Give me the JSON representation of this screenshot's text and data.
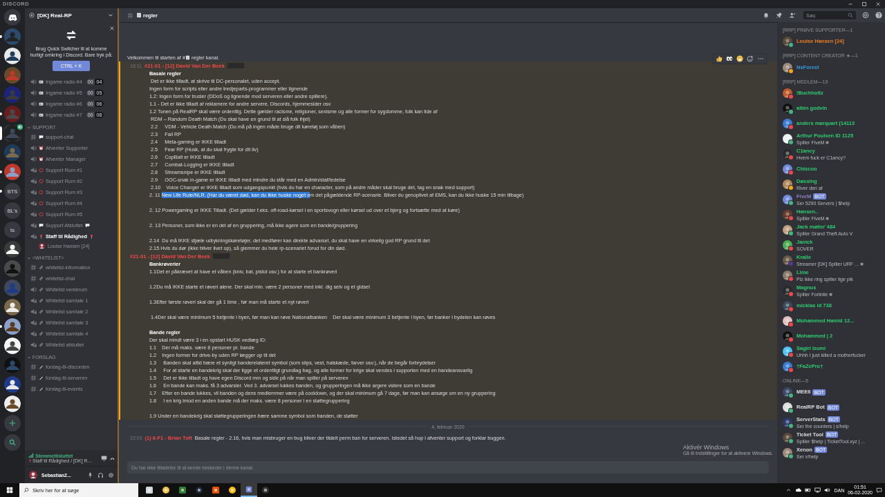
{
  "titlebar": {
    "app": "DISCORD"
  },
  "servers": [
    {
      "kind": "home",
      "selected": false,
      "unread": false
    },
    {
      "kind": "picture",
      "selected": false,
      "unread": true
    },
    {
      "kind": "picture",
      "selected": false,
      "unread": false
    },
    {
      "kind": "picture",
      "selected": false,
      "unread": false
    },
    {
      "kind": "picture",
      "selected": false,
      "unread": false
    },
    {
      "kind": "picture",
      "selected": false,
      "unread": true
    },
    {
      "kind": "picture",
      "selected": true,
      "unread": false,
      "voice": true
    },
    {
      "kind": "picture",
      "selected": false,
      "unread": false
    },
    {
      "kind": "picture",
      "selected": false,
      "unread": true
    },
    {
      "kind": "text",
      "label": "BTS",
      "selected": false,
      "unread": true
    },
    {
      "kind": "text",
      "label": "BL's",
      "selected": false,
      "unread": false
    },
    {
      "kind": "text",
      "label": "ts",
      "selected": false,
      "unread": false
    },
    {
      "kind": "picture",
      "selected": false,
      "unread": false
    },
    {
      "kind": "picture",
      "selected": false,
      "unread": false
    },
    {
      "kind": "picture",
      "selected": false,
      "unread": false
    },
    {
      "kind": "picture",
      "selected": false,
      "unread": false
    },
    {
      "kind": "picture",
      "selected": false,
      "unread": true
    },
    {
      "kind": "picture",
      "selected": false,
      "unread": false
    },
    {
      "kind": "picture",
      "selected": false,
      "unread": false
    },
    {
      "kind": "picture",
      "selected": false,
      "unread": false
    },
    {
      "kind": "picture",
      "selected": false,
      "unread": false
    },
    {
      "kind": "add",
      "selected": false,
      "unread": false
    },
    {
      "kind": "explore",
      "selected": false,
      "unread": false
    }
  ],
  "guild": {
    "name": "[DK] Real-RP"
  },
  "quick_switcher": {
    "text": "Brug Quick Switcher til at komme hurtigt omkring i Discord. Bare tryk på:",
    "shortcut": "CTRL + K"
  },
  "channel_groups": [
    {
      "channels": [
        {
          "icons": [
            {
              "kind": "speaker"
            },
            {
              "kind": "radio"
            }
          ],
          "name": "Ingame radio #4",
          "counts": [
            "00",
            "04"
          ]
        },
        {
          "icons": [
            {
              "kind": "speaker"
            },
            {
              "kind": "radio"
            }
          ],
          "name": "Ingame radio #5",
          "counts": [
            "00",
            "05"
          ]
        },
        {
          "icons": [
            {
              "kind": "speaker"
            },
            {
              "kind": "radio"
            }
          ],
          "name": "Ingame radio #6",
          "counts": [
            "00",
            "06"
          ]
        },
        {
          "icons": [
            {
              "kind": "speaker"
            },
            {
              "kind": "radio"
            }
          ],
          "name": "Ingame radio #7",
          "counts": [
            "00",
            "08"
          ]
        }
      ]
    },
    {
      "name": "SUPPORT",
      "expanded": true,
      "channels": [
        {
          "icons": [
            {
              "kind": "hash"
            },
            {
              "kind": "speech"
            }
          ],
          "name": "support-chat"
        },
        {
          "icons": [
            {
              "kind": "speaker"
            },
            {
              "kind": "clock"
            }
          ],
          "name": "Afventer Supporter"
        },
        {
          "icons": [
            {
              "kind": "speaker"
            },
            {
              "kind": "clock"
            }
          ],
          "name": "Afventer Manager"
        },
        {
          "icons": [
            {
              "kind": "locked"
            },
            {
              "kind": "ring"
            }
          ],
          "name": "Support Rum #1"
        },
        {
          "icons": [
            {
              "kind": "locked"
            },
            {
              "kind": "ring"
            }
          ],
          "name": "Support Rum #2"
        },
        {
          "icons": [
            {
              "kind": "locked"
            },
            {
              "kind": "ring"
            }
          ],
          "name": "Support Rum #3"
        },
        {
          "icons": [
            {
              "kind": "locked"
            },
            {
              "kind": "ring"
            }
          ],
          "name": "Support Rum #4"
        },
        {
          "icons": [
            {
              "kind": "locked"
            },
            {
              "kind": "ring"
            }
          ],
          "name": "Support Rum #5"
        },
        {
          "icons": [
            {
              "kind": "locked"
            },
            {
              "kind": "speech"
            }
          ],
          "icons_after": [
            {
              "kind": "speech"
            }
          ],
          "name": "Support Afsluttet"
        },
        {
          "icons": [
            {
              "kind": "locked"
            },
            {
              "kind": "pin"
            }
          ],
          "icons_after": [
            {
              "kind": "pin"
            }
          ],
          "name": "Staff til Rådighed",
          "connected": true,
          "members": [
            {
              "name": "Louise Hansen [24]"
            }
          ]
        }
      ]
    },
    {
      "name": "=WHITELIST=",
      "expanded": true,
      "channels": [
        {
          "icons": [
            {
              "kind": "hash"
            },
            {
              "kind": "link"
            }
          ],
          "name": "whitelist-information"
        },
        {
          "icons": [
            {
              "kind": "hash"
            },
            {
              "kind": "link"
            }
          ],
          "name": "whitelist-chat"
        },
        {
          "icons": [
            {
              "kind": "speaker"
            },
            {
              "kind": "link"
            }
          ],
          "name": "Whitelist venterum"
        },
        {
          "icons": [
            {
              "kind": "locked"
            },
            {
              "kind": "link"
            }
          ],
          "name": "Whitelist samtale 1"
        },
        {
          "icons": [
            {
              "kind": "locked"
            },
            {
              "kind": "link"
            }
          ],
          "name": "Whitelist samtale 2"
        },
        {
          "icons": [
            {
              "kind": "locked"
            },
            {
              "kind": "link"
            }
          ],
          "name": "Whitelist samtale 3"
        },
        {
          "icons": [
            {
              "kind": "locked"
            },
            {
              "kind": "link"
            }
          ],
          "name": "Whitelist samtale 4"
        },
        {
          "icons": [
            {
              "kind": "locked"
            },
            {
              "kind": "link"
            }
          ],
          "name": "Whitelist afsluttet"
        }
      ]
    },
    {
      "name": "FORSLAG",
      "expanded": true,
      "channels": [
        {
          "icons": [
            {
              "kind": "hash"
            },
            {
              "kind": "pencil"
            }
          ],
          "name": "forslag-til-discorden"
        },
        {
          "icons": [
            {
              "kind": "hash"
            },
            {
              "kind": "pencil"
            }
          ],
          "name": "forslag-til-serveren"
        },
        {
          "icons": [
            {
              "kind": "hash"
            },
            {
              "kind": "pencil"
            }
          ],
          "name": "forslag-til-events"
        }
      ]
    }
  ],
  "voice_panel": {
    "status": "Stemmetilsluttet",
    "location": "Staff til Rådighed / [DK] R..."
  },
  "user_panel": {
    "name": "Sebastian2..."
  },
  "channel": {
    "name": "regler"
  },
  "search": {
    "placeholder": "Søg"
  },
  "welcome": {
    "before": "Velkommen til starten af #",
    "after": "regler kanal."
  },
  "messages": [
    {
      "kind": "group",
      "time": "16:11",
      "author": "#21-01 - [12] David Van Der Beek",
      "color": "#f04747",
      "mentioned": true,
      "hovered": true,
      "lines": [
        {
          "kind": "heading",
          "text": "Basale regler"
        },
        {
          "kind": "text",
          "text": " Det er ikke tilladt, at skrive til DC-personalet, uden accept."
        },
        {
          "kind": "text",
          "text": "Ingen form for scripts eller andre tredjeparts-programmer eller lignende"
        },
        {
          "kind": "text",
          "text": "1.2: Ingen form for trusler (DDoS og lignende mod serveren eller andre spillere)."
        },
        {
          "kind": "text",
          "text": "1.1 - Det er ikke tilladt af reklamere for andre servere, Discords, hjemmesider osv"
        },
        {
          "kind": "text",
          "text": "1.2 Tonen på RealRP skal være ordentlig. Dette gælder racisme, religioner, sexisme og alle former for sygdomme, folk kan lide af"
        },
        {
          "kind": "text",
          "text": " RDM – Random Death Match (Du skal have en grund til at slå folk ihjel)"
        },
        {
          "kind": "text",
          "text": " 2.2     VDM - Vehicle Death Match (Du må på ingen måde bruge dit køretøj som våben)"
        },
        {
          "kind": "text",
          "text": " 2.3     Fail RP"
        },
        {
          "kind": "text",
          "text": " 2.4     Meta-gaming er IKKE tilladt"
        },
        {
          "kind": "text",
          "text": " 2.5     Fear RP (Husk, at du skal frygte for dit liv)"
        },
        {
          "kind": "text",
          "text": " 2.6     CopBait er IKKE tilladt"
        },
        {
          "kind": "text",
          "text": " 2.7     Combat-Logging er IKKE tilladt"
        },
        {
          "kind": "text",
          "text": " 2.8     Streamsnipe er IKKE tilladt"
        },
        {
          "kind": "text",
          "text": " 2.9     OOC-snak in-game er IKKE tilladt med mindre du står med en Admin/staf/ledelse"
        },
        {
          "kind": "text",
          "text": " 2.10    Voice Changer er IKKE tilladt som udgangspunkt (hvis du har en character, som på andre måder skal bruge det, tag en snak med support)"
        },
        {
          "kind": "segments",
          "segments": [
            {
              "text": "2. 11",
              "selected": false
            },
            {
              "text": "New Life Rule/NLR. (Har du været død, kan du ikke huske noget o",
              "selected": true
            },
            {
              "text": "m det pågældende RP-scenarie. Bliver du genoplivet af EMS, kan du ikke huske 15 min tilbage)",
              "selected": false
            }
          ]
        },
        {
          "kind": "gap"
        },
        {
          "kind": "text",
          "text": "2. 12 Powergaming er IKKE Tilladt. (Det gælder f.eks. off-road-kørsel i en sportsvogn eller kørsel ud over et bjerg og fortsætte med at køre)"
        },
        {
          "kind": "gap"
        },
        {
          "kind": "text",
          "text": "2. 13 Personer, som ikke er en del af en gruppering, må ikke agere som en bande/gruppering"
        },
        {
          "kind": "gap"
        },
        {
          "kind": "text",
          "text": "2.14  Du må IKKE stjæle udrykningskøretøjer, det medfører kan direkte advarsel, du skal have en virkelig god RP grund til det"
        },
        {
          "kind": "text",
          "text": "2.15 Hvis du dør (ikke bliver livet op), så glemmer du hele rp-scenariet forud for din død."
        }
      ]
    },
    {
      "kind": "group",
      "author": "#21-01 - [12] David Van Der Beek",
      "color": "#f04747",
      "mentioned": true,
      "hovered": false,
      "lines": [
        {
          "kind": "heading",
          "text": "Bankrøverier"
        },
        {
          "kind": "text",
          "text": "1.1Det er påkrævet at have et våben (kniv, bat, pistol osv.) for at starte et bankrøveri"
        },
        {
          "kind": "gap"
        },
        {
          "kind": "text",
          "text": "1.2Du må IKKE starte et røveri alene. Der skal min. være 2 personer med inkl. dig selv og et gidsel"
        },
        {
          "kind": "gap"
        },
        {
          "kind": "text",
          "text": "1.3Efter første røveri skal der gå 1 time , før man må starte et nyt røveri"
        },
        {
          "kind": "gap"
        },
        {
          "kind": "text",
          "text": " 1.4Der skal være minimum 5 betjente i byen, før man kan røve Nationalbanken    Der skal være minimum 3 betjente i byen, før banker i bydelen kan røves"
        },
        {
          "kind": "gap"
        },
        {
          "kind": "heading",
          "text": "Bande regler"
        },
        {
          "kind": "text",
          "text": "Der skal mindt være 3 i en opstart HUSK vedlæg ID:"
        },
        {
          "kind": "text",
          "text": "1.1    Der må maks. være 8 personer pr. bande"
        },
        {
          "kind": "text",
          "text": "1.2    Ingen former for drive-by uden RP lægger op til det"
        },
        {
          "kind": "text",
          "text": "1.3     Banden skal altid bære et synligt banderelateret symbol (som slips, vest, halskæde, farver osv.), når de begår forbrydelser"
        },
        {
          "kind": "text",
          "text": "1.4     For at starte en bandekrig skal der ligge et ordentligt grundlag bag, og alle former for krige skal vendes i supporten med en bandeansvarlig"
        },
        {
          "kind": "text",
          "text": "1.5     Det er ikke tilladt og have egen Discord mm og side på når man spiller på serveren"
        },
        {
          "kind": "text",
          "text": "1.6     En bande kan maks. få 3 advarsler. Ved 3. advarsel lukkes banden, og grupperingen må ikke argere videre som en bande"
        },
        {
          "kind": "text",
          "text": "1.7    Efter en bande lukkes, vil banden og dens medlemmer være på cooldown, og der skal minimum gå 7 dage, før man kan ansøge om en ny gruppering"
        },
        {
          "kind": "text",
          "text": "1.8     I en krig imod en anden bande må der maks. være 8 personer i en støttegruppering"
        },
        {
          "kind": "gap"
        },
        {
          "kind": "text",
          "text": "1.9 Under en bandekrig skal støttegrupperingen bære samme symbol som banden, de støtter"
        }
      ]
    },
    {
      "kind": "divider",
      "text": "4. februar 2020"
    },
    {
      "kind": "inline",
      "time": "22:03",
      "author": "(1) 6-F1 - Brian Toft",
      "color": "#f04747",
      "text": "Basale regler - 2.16, hvis man misbruger en bug bliver der tildelt perm ban for serveren. Istedet så hop i afventer support og forklar buggen."
    }
  ],
  "composer": {
    "placeholder": "Du har ikke tilladelse til at sende beskeder i denne kanal."
  },
  "activation": {
    "title": "Aktivér Windows",
    "text": "Gå til Indstillinger for at aktivere Windows."
  },
  "member_groups": [
    {
      "name": "[RRP] PRØVE SUPPORTER—1",
      "members": [
        {
          "name": "Louise Hansen [24]",
          "color": "#e67e22",
          "status": {
            "color": "#43b581"
          }
        }
      ]
    },
    {
      "name": "[RRP] CONTENT CREATOR ★—1",
      "members": [
        {
          "name": "NsForest",
          "color": "#3498db",
          "status": {
            "color": "#faa61a"
          }
        }
      ]
    },
    {
      "name": "[RRP] MEDLEM—19",
      "members": [
        {
          "name": "!Buchholtz",
          "color": "#2ecc71",
          "status": {
            "color": "#f04747"
          }
        },
        {
          "name": "albin godvin",
          "color": "#2ecc71",
          "status": {
            "color": "#43b581"
          }
        },
        {
          "name": "anders marquart (14113",
          "color": "#2ecc71",
          "status": {
            "color": "#f04747"
          }
        },
        {
          "name": "Arthur Poulsen ID 1125",
          "color": "#2ecc71",
          "status": {
            "color": "#43b581"
          },
          "activity": "Spiller FiveM",
          "rich_presence": true
        },
        {
          "name": "C1ancy",
          "color": "#2ecc71",
          "status": {
            "color": "#f04747"
          },
          "activity": "Hvem fuck er C1ancy?"
        },
        {
          "name": "Chiscoo",
          "color": "#2ecc71",
          "status": {
            "color": "#f04747"
          }
        },
        {
          "name": "Døssing",
          "color": "#2ecc71",
          "status": {
            "color": "#faa61a"
          },
          "activity": "River den af"
        },
        {
          "name": "FiveM",
          "color": "#8e7cc3",
          "status": {
            "color": "#43b581"
          },
          "tag": "BOT",
          "activity": "Ser 5290 Servers | $help"
        },
        {
          "name": "Hansen..",
          "color": "#2ecc71",
          "status": {
            "color": "#f04747"
          },
          "activity": "Spiller FiveM",
          "rich_presence": true
        },
        {
          "name": "Jack møller`484",
          "color": "#2ecc71",
          "status": {
            "color": "#43b581"
          },
          "activity": "Spiller Grand Theft Auto V"
        },
        {
          "name": "Janick",
          "color": "#2ecc71",
          "status": {
            "color": "#f04747"
          },
          "activity": "SOVER"
        },
        {
          "name": "Kralle",
          "color": "#2ecc71",
          "status": {
            "color": "#593695"
          },
          "activity": "Streamer [DK] Spiller URF ...",
          "rich_presence": true
        },
        {
          "name": "Lime",
          "color": "#2ecc71",
          "status": {
            "color": "#f04747"
          },
          "activity": "Plz ikke ring spiller lige pik"
        },
        {
          "name": "Magnus",
          "color": "#2ecc71",
          "status": {
            "color": "#f04747"
          },
          "activity": "Spiller Fortnite",
          "rich_presence": true
        },
        {
          "name": "micklas id 738",
          "color": "#2ecc71",
          "status": {
            "color": "#f04747"
          }
        },
        {
          "name": "Mohammed Hamid 12...",
          "color": "#2ecc71",
          "status": {
            "color": "#f04747"
          }
        },
        {
          "name": "Mohammed | 2",
          "color": "#2ecc71",
          "status": {
            "color": "#f04747"
          }
        },
        {
          "name": "Sagiri Izumi",
          "color": "#2ecc71",
          "status": {
            "color": "#f04747"
          },
          "activity": "Uhhh I just killed a motherfucker"
        },
        {
          "name": "†FaZePro†",
          "color": "#2ecc71",
          "status": {
            "color": "#f04747"
          }
        }
      ]
    },
    {
      "name": "ONLINE—5",
      "members": [
        {
          "name": "MEE6",
          "color": "#dcddde",
          "status": {
            "color": "#43b581"
          },
          "tag": "BOT"
        },
        {
          "name": "RealRP Bot",
          "color": "#dcddde",
          "status": {
            "color": "#43b581"
          },
          "tag": "BOT"
        },
        {
          "name": "ServerStats",
          "color": "#dcddde",
          "status": {
            "color": "#43b581"
          },
          "tag": "BOT",
          "activity": "Ser the counters | s/help"
        },
        {
          "name": "Ticket Tool",
          "color": "#dcddde",
          "status": {
            "color": "#43b581"
          },
          "tag": "BOT",
          "activity": "Spiller $help | TicketTool.xyz | ..."
        },
        {
          "name": "Xenon",
          "color": "#dcddde",
          "status": {
            "color": "#43b581"
          },
          "tag": "BOT",
          "activity": "Ser x!help"
        }
      ]
    }
  ],
  "taskbar": {
    "search_placeholder": "Skriv her for at søge",
    "language": "DAN",
    "time": "01:51",
    "date": "06-02-2020"
  }
}
